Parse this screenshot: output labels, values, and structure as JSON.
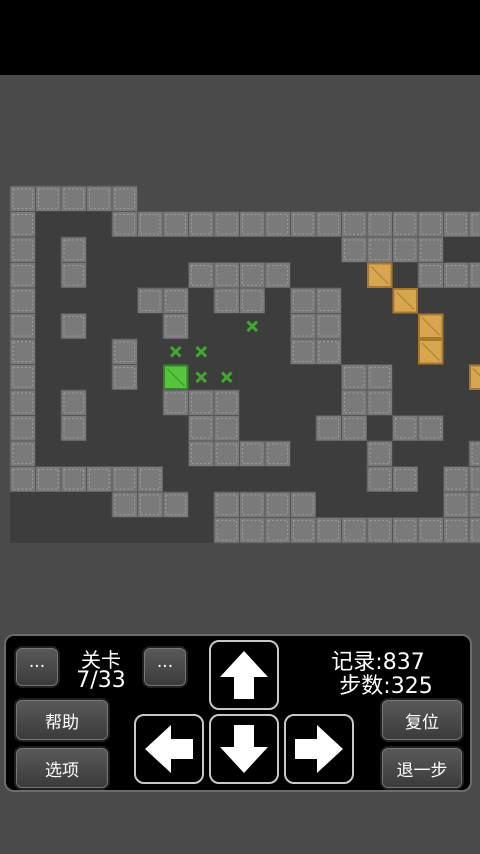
{
  "level": {
    "label": "关卡",
    "value": "7/33"
  },
  "record": {
    "label": "记录:",
    "value": "837"
  },
  "steps": {
    "label": "步数:",
    "value": "325"
  },
  "buttons": {
    "more_left": "···",
    "more_right": "···",
    "help": "帮助",
    "options": "选项",
    "reset": "复位",
    "undo": "退一步"
  },
  "icons": {
    "up": "arrow-up-icon",
    "down": "arrow-down-icon",
    "left": "arrow-left-icon",
    "right": "arrow-right-icon"
  },
  "colors": {
    "wall": "#7a7a7a",
    "floor": "#3d3d3d",
    "target": "#3faa2e",
    "box": "#d8a64f",
    "goal_done": "#56c43c",
    "background": "#4a4a4a"
  },
  "game": {
    "map": [
      "#####",
      "#   #######################",
      "# #          ####      ##",
      "# #    ####   $ ###  ##",
      "#    ## ## ##  $      #",
      "# #   #  . ##   $    ##",
      "#   # ..   ##   $    ##",
      "#   # *..    ##   $    #",
      "# #   ###    ##    $   #",
      "# #    ##   ## ##  @   ##",
      "#      ####   #   ## ###",
      "######        ## ## #   #",
      "    ### ####     ### ** #",
      "        #################"
    ],
    "legend": {
      "#": "wall",
      " ": "floor",
      "$": "box",
      ".": "target",
      "*": "box-on-target",
      "@": "player"
    }
  }
}
